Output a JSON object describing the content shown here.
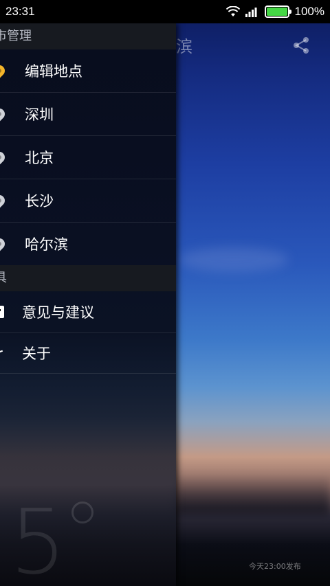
{
  "status_bar": {
    "time": "23:31",
    "battery": "100%"
  },
  "header": {
    "city_partial": "滨"
  },
  "drawer": {
    "section_city": "市管理",
    "cities": [
      {
        "label": "编辑地点",
        "icon": "pin-active-icon"
      },
      {
        "label": "深圳",
        "icon": "pin-icon"
      },
      {
        "label": "北京",
        "icon": "pin-icon"
      },
      {
        "label": "长沙",
        "icon": "pin-icon"
      },
      {
        "label": "哈尔滨",
        "icon": "pin-icon"
      }
    ],
    "section_tools": "具",
    "tools": [
      {
        "label": "意见与建议",
        "icon": "feedback-icon"
      },
      {
        "label": "关于",
        "icon": "about-icon"
      }
    ]
  },
  "ghost": {
    "temperature": "5"
  },
  "footer": {
    "publish_note": "今天23:00发布"
  },
  "colors": {
    "accent_pin": "#f4b52a",
    "battery": "#45d645"
  }
}
